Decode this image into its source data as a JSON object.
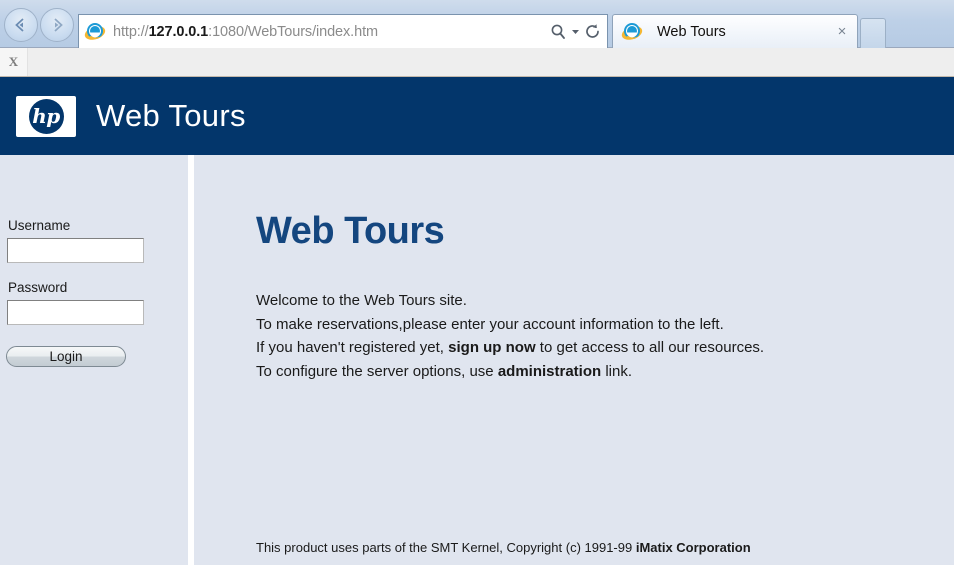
{
  "browser": {
    "back_label": "Back",
    "forward_label": "Forward",
    "url_scheme": "http://",
    "url_host": "127.0.0.1",
    "url_rest": ":1080/WebTours/index.htm",
    "url_full": "http://127.0.0.1:1080/WebTours/index.htm",
    "search_icon": "search-icon",
    "dropdown_icon": "chevron-down-icon",
    "refresh_icon": "refresh-icon",
    "tab": {
      "title": "Web Tours",
      "favicon": "internet-explorer-icon",
      "close_label": "×"
    },
    "new_tab_label": "",
    "command_bar_close_label": "X"
  },
  "site": {
    "banner": {
      "logo_text": "hp",
      "title": "Web Tours"
    },
    "login": {
      "username_label": "Username",
      "username_value": "",
      "password_label": "Password",
      "password_value": "",
      "submit_label": "Login"
    },
    "main": {
      "heading": "Web Tours",
      "line1": "Welcome to the Web Tours site.",
      "line2": "To make reservations,please enter your account information to the left.",
      "line3_a": "If you haven't registered yet, ",
      "line3_link": "sign up now",
      "line3_b": " to get access to all our resources.",
      "line4_a": "To configure the server options, use ",
      "line4_link": "administration",
      "line4_b": " link."
    },
    "footer": {
      "text": "This product uses parts of the SMT Kernel, Copyright (c) 1991-99 ",
      "company": "iMatix Corporation"
    }
  },
  "colors": {
    "banner_navy": "#03366b",
    "page_bg": "#e0e5ef",
    "heading_blue": "#14467f",
    "chrome_blue": "#bdd0e7"
  }
}
